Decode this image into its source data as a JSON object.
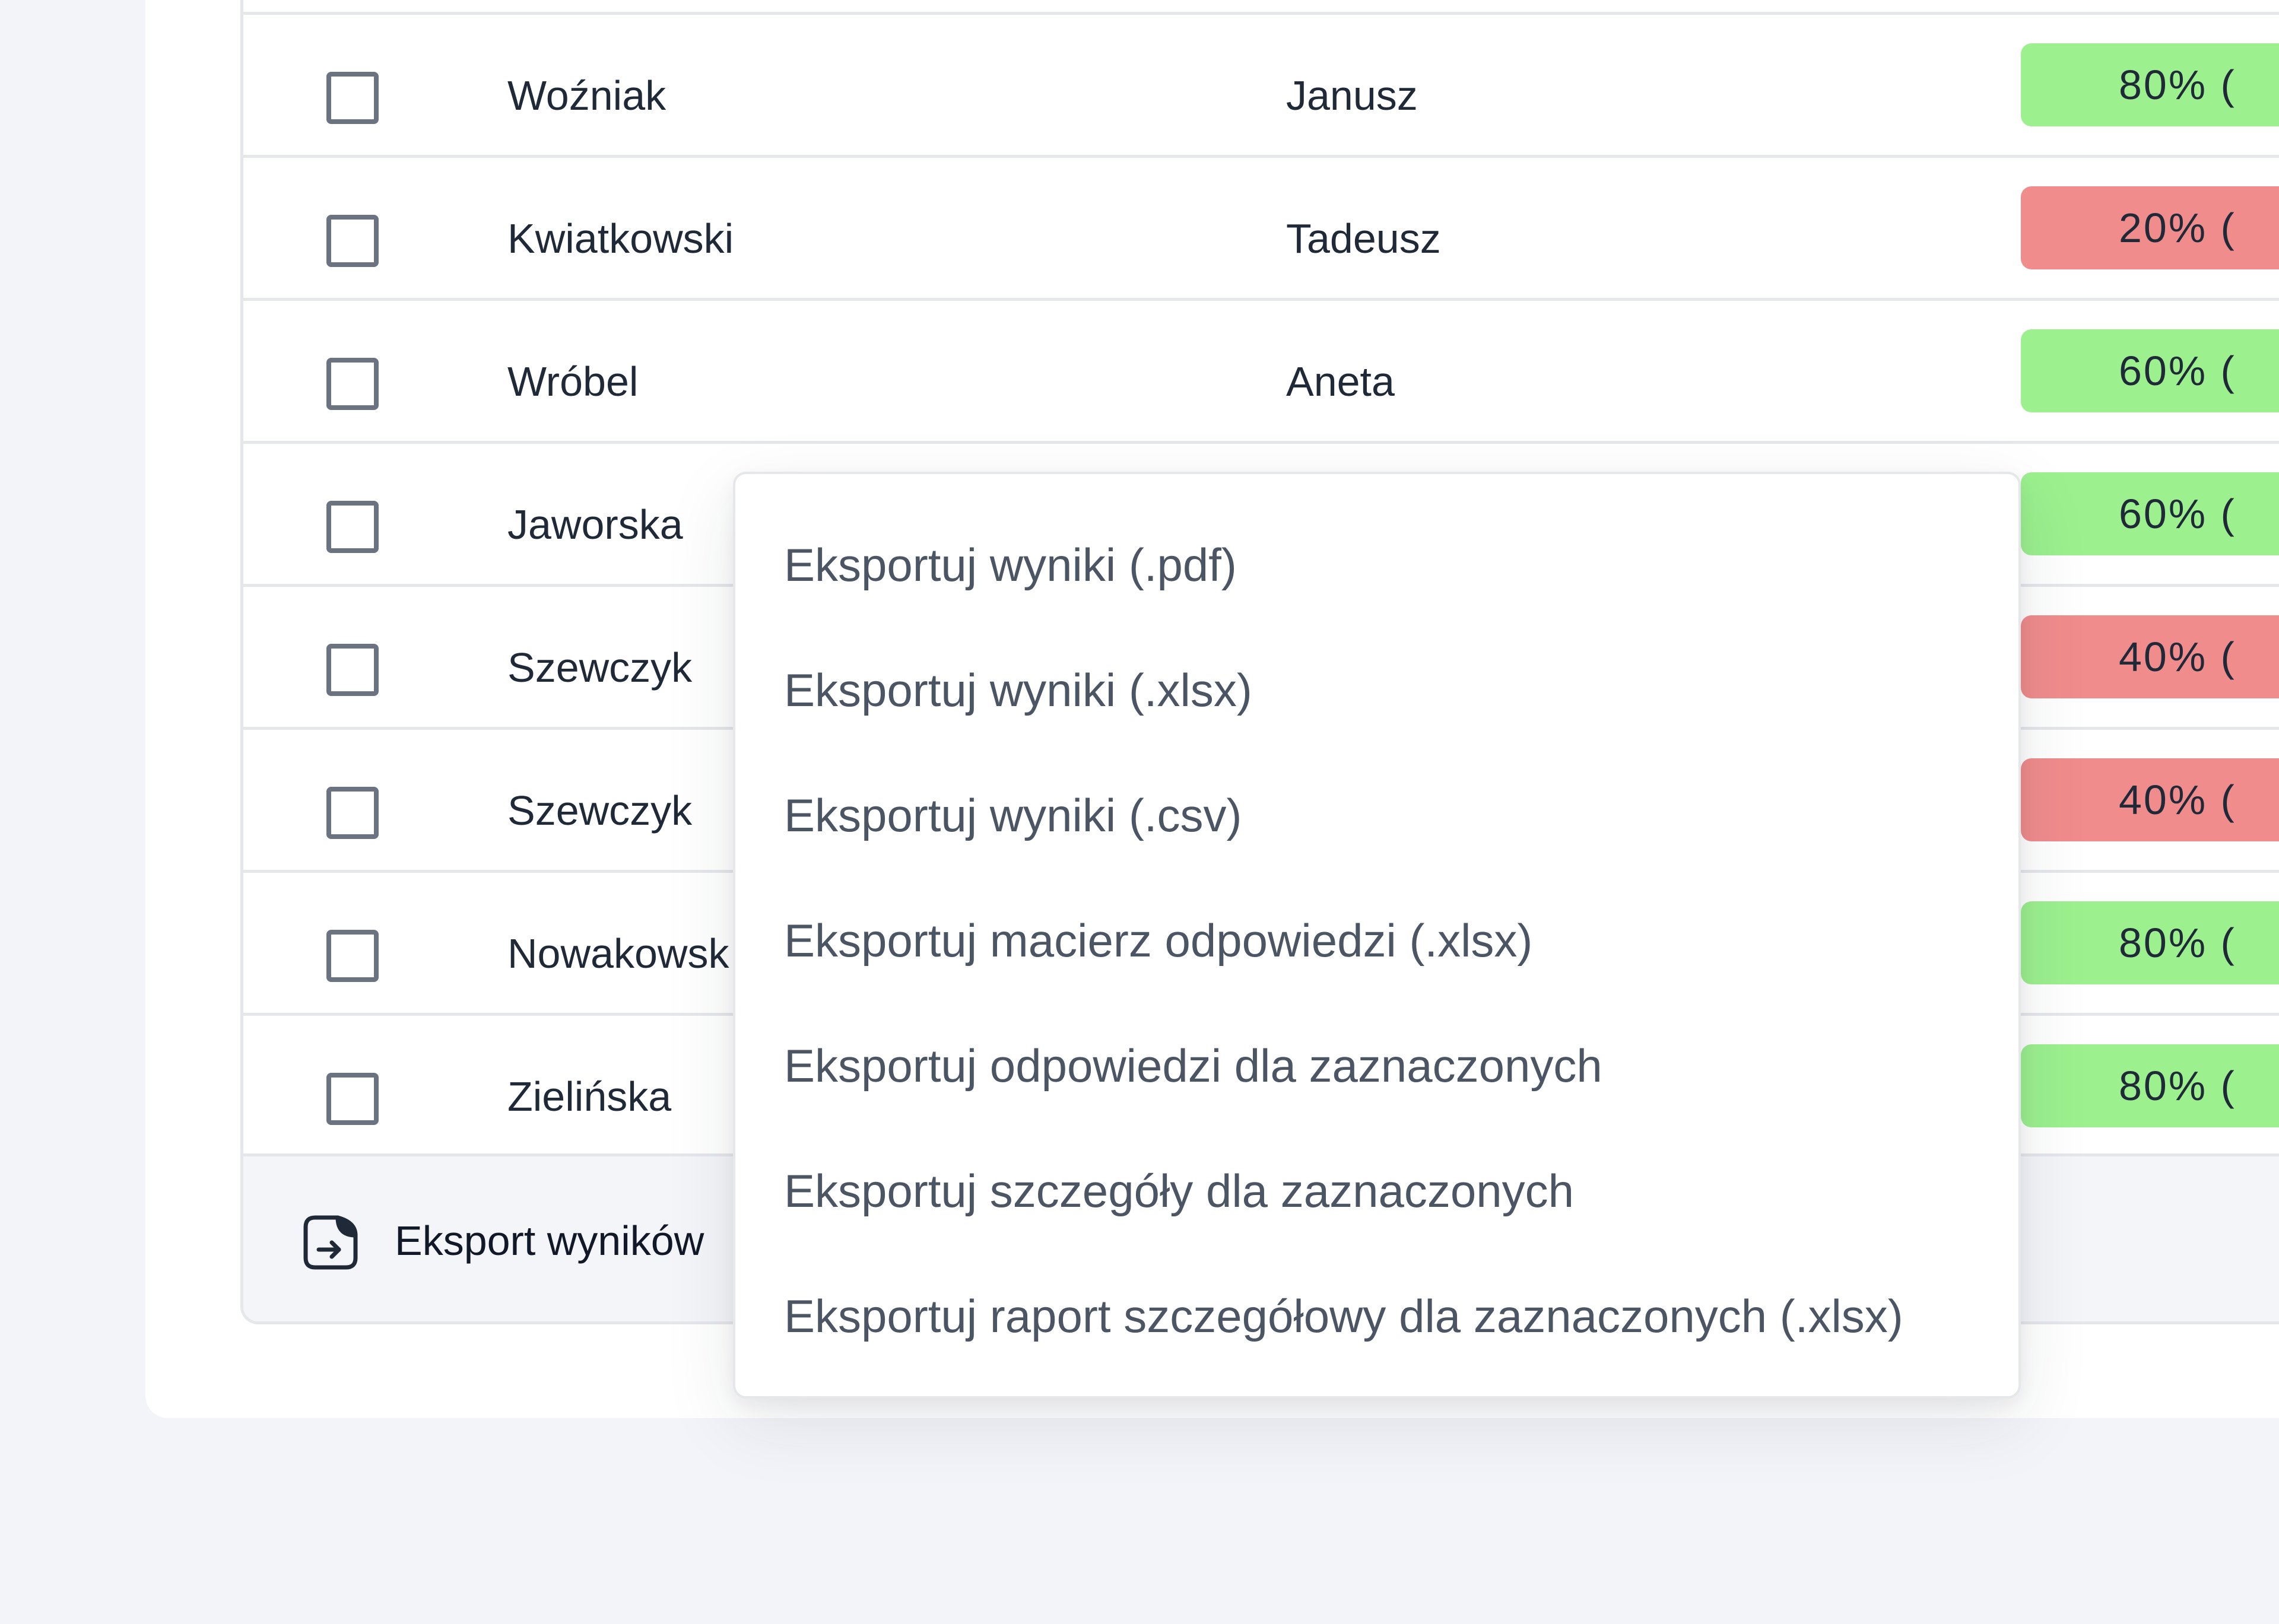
{
  "rows": [
    {
      "last": "Woźniak",
      "first": "Janusz",
      "score": "80% (",
      "status": "pass"
    },
    {
      "last": "Kwiatkowski",
      "first": "Tadeusz",
      "score": "20% (",
      "status": "fail"
    },
    {
      "last": "Wróbel",
      "first": "Aneta",
      "score": "60% (",
      "status": "pass"
    },
    {
      "last": "Jaworska",
      "first": "",
      "score": "60% (",
      "status": "pass"
    },
    {
      "last": "Szewczyk",
      "first": "",
      "score": "40% (",
      "status": "fail"
    },
    {
      "last": "Szewczyk",
      "first": "",
      "score": "40% (",
      "status": "fail"
    },
    {
      "last": "Nowakowsk",
      "first": "",
      "score": "80% (",
      "status": "pass"
    },
    {
      "last": "Zielińska",
      "first": "",
      "score": "80% (",
      "status": "pass"
    }
  ],
  "footer": {
    "export_label": "Eksport wyników",
    "icon": "file-export-icon"
  },
  "export_menu": {
    "items": [
      "Eksportuj wyniki (.pdf)",
      "Eksportuj wyniki (.xlsx)",
      "Eksportuj wyniki (.csv)",
      "Eksportuj macierz odpowiedzi (.xlsx)",
      "Eksportuj odpowiedzi dla zaznaczonych",
      "Eksportuj szczegóły dla zaznaczonych",
      "Eksportuj raport szczegółowy dla zaznaczonych (.xlsx)"
    ]
  },
  "colors": {
    "pass": "#9cf08e",
    "fail": "#f18c8c",
    "border": "#e5e7eb",
    "background": "#f3f4f9"
  }
}
